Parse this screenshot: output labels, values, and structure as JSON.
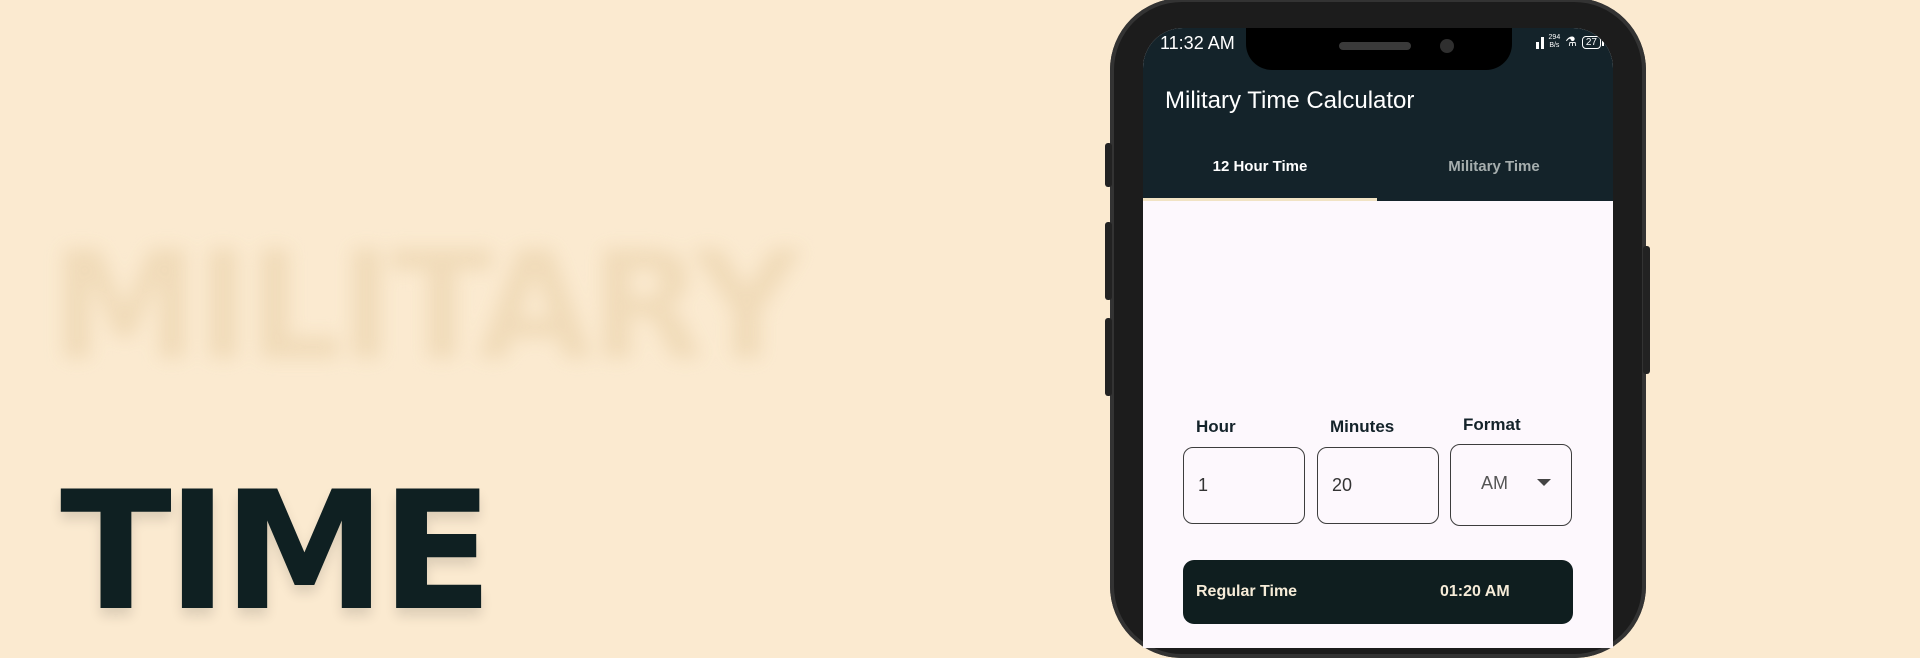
{
  "hero": {
    "ghost_word": "MILITARY",
    "main_word": "TIME"
  },
  "status_bar": {
    "time": "11:32 AM",
    "net_speed_value": "294",
    "net_speed_unit": "B/s",
    "battery": "27"
  },
  "app": {
    "title": "Military Time Calculator",
    "tabs": [
      {
        "label": "12 Hour Time",
        "selected": true
      },
      {
        "label": "Military Time",
        "selected": false
      }
    ]
  },
  "form": {
    "hour_label": "Hour",
    "hour_value": "1",
    "minutes_label": "Minutes",
    "minutes_value": "20",
    "format_label": "Format",
    "format_value": "AM"
  },
  "result": {
    "label": "Regular Time",
    "value": "01:20 AM"
  },
  "colors": {
    "background": "#fbead0",
    "appbar": "#14232a",
    "accent": "#f1e3c4",
    "result_card": "#0f1e1f"
  }
}
